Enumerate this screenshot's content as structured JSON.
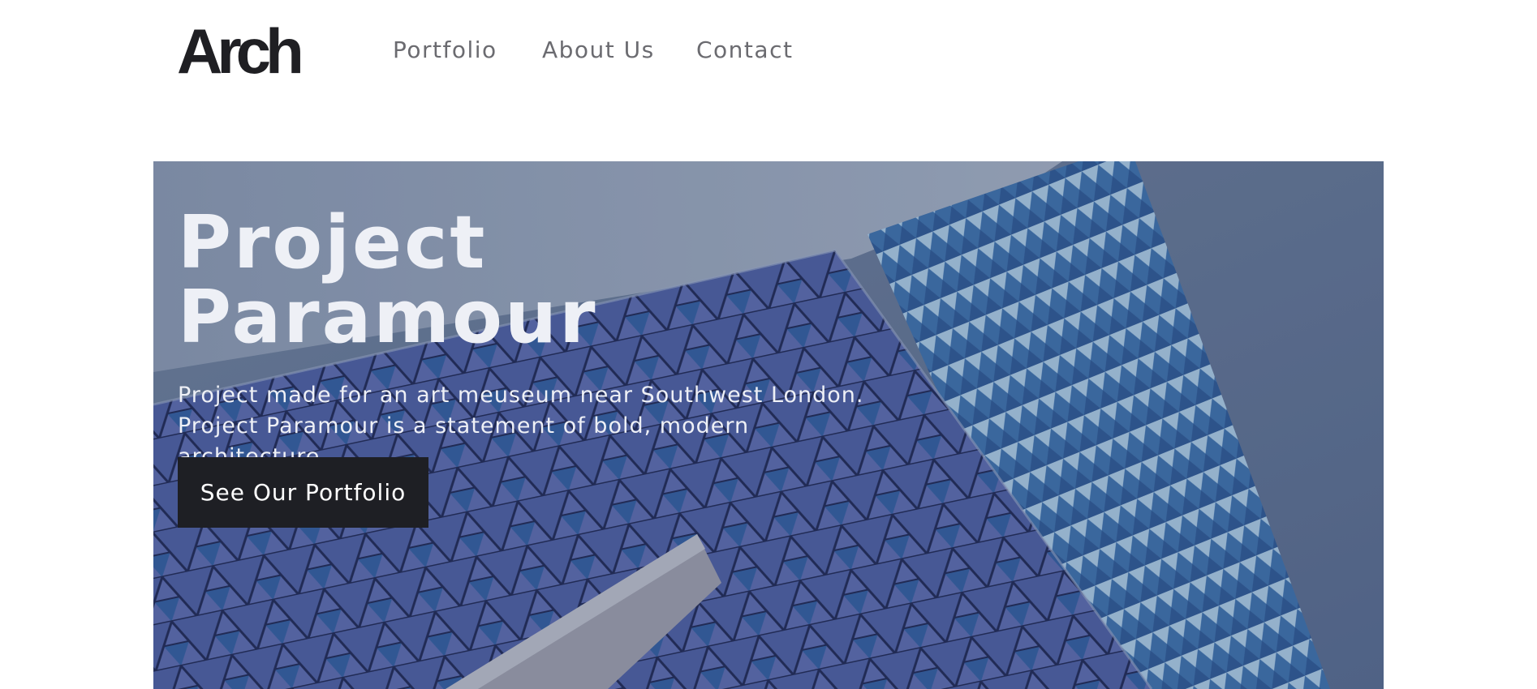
{
  "header": {
    "logo_text": "Arch",
    "nav": {
      "portfolio": "Portfolio",
      "about": "About Us",
      "contact": "Contact"
    }
  },
  "hero": {
    "title_line1": "Project",
    "title_line2": "Paramour",
    "description": "Project made for an art meuseum near Southwest London. Project Paramour is a statement of bold, modern architecture.",
    "cta_label": "See Our Portfolio"
  },
  "colors": {
    "text_dark": "#1f1f23",
    "nav_text": "#6b6b70",
    "button_bg": "#1e1f24",
    "hero_text": "#eef0f6"
  }
}
